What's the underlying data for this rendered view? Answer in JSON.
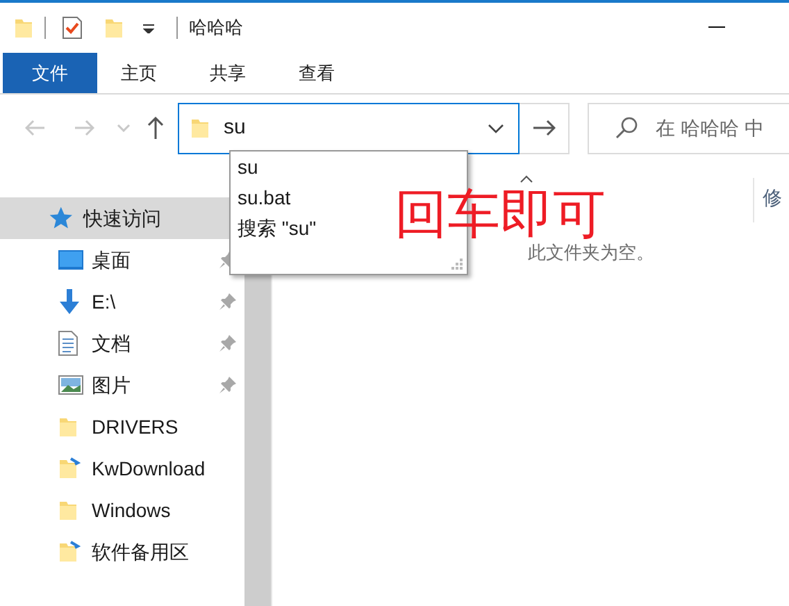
{
  "title_bar": {
    "title": "哈哈哈"
  },
  "ribbon_tabs": [
    {
      "label": "文件",
      "selected": true
    },
    {
      "label": "主页",
      "selected": false
    },
    {
      "label": "共享",
      "selected": false
    },
    {
      "label": "查看",
      "selected": false
    }
  ],
  "address_bar": {
    "value": "su"
  },
  "search": {
    "placeholder": "在 哈哈哈 中"
  },
  "suggestions": [
    "su",
    "su.bat",
    "搜索 \"su\""
  ],
  "sidebar": {
    "items": [
      {
        "label": "快速访问",
        "kind": "star",
        "selected": true,
        "children": [
          {
            "label": "桌面",
            "kind": "desktop",
            "pinned": true
          },
          {
            "label": "E:\\",
            "kind": "download",
            "pinned": true
          },
          {
            "label": "文档",
            "kind": "document",
            "pinned": true
          },
          {
            "label": "图片",
            "kind": "picture",
            "pinned": true
          },
          {
            "label": "DRIVERS",
            "kind": "folder",
            "pinned": false
          },
          {
            "label": "KwDownload",
            "kind": "linked-folder",
            "pinned": false
          },
          {
            "label": "Windows",
            "kind": "folder",
            "pinned": false
          },
          {
            "label": "软件备用区",
            "kind": "linked-folder",
            "pinned": false
          }
        ]
      }
    ]
  },
  "content": {
    "column_1": "修",
    "empty_message": "此文件夹为空。"
  },
  "annotation": "回车即可"
}
